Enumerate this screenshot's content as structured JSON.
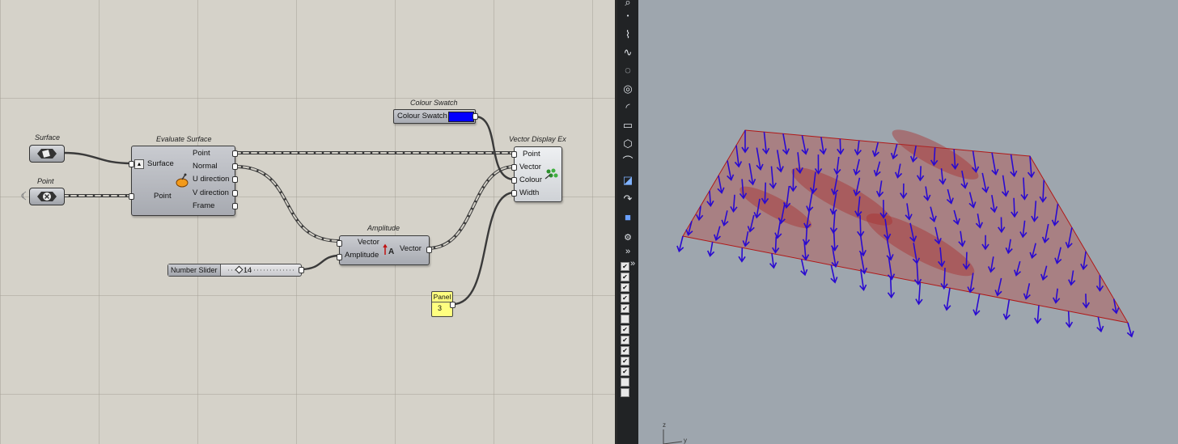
{
  "canvas": {
    "components": {
      "surface": {
        "nickname": "Surface"
      },
      "point": {
        "nickname": "Point"
      },
      "evaluate_surface": {
        "nickname": "Evaluate Surface",
        "inputs": [
          "Surface",
          "Point"
        ],
        "outputs": [
          "Point",
          "Normal",
          "U direction",
          "V direction",
          "Frame"
        ]
      },
      "colour_swatch": {
        "nickname": "Colour Swatch",
        "label": "Colour Swatch",
        "color": "#0000ff"
      },
      "vector_display": {
        "nickname": "Vector Display Ex",
        "inputs": [
          "Point",
          "Vector",
          "Colour",
          "Width"
        ]
      },
      "amplitude": {
        "nickname": "Amplitude",
        "inputs": [
          "Vector",
          "Amplitude"
        ],
        "outputs": [
          "Vector"
        ]
      },
      "number_slider": {
        "label": "Number Slider",
        "value": "14"
      },
      "panel": {
        "label": "Panel",
        "value": "3"
      }
    }
  },
  "toolbar": {
    "tabs_label": "»"
  },
  "viewport": {
    "axis_z": "z",
    "axis_y": "y",
    "surface_color": "#b06060",
    "vector_color": "#2a0ad0"
  }
}
